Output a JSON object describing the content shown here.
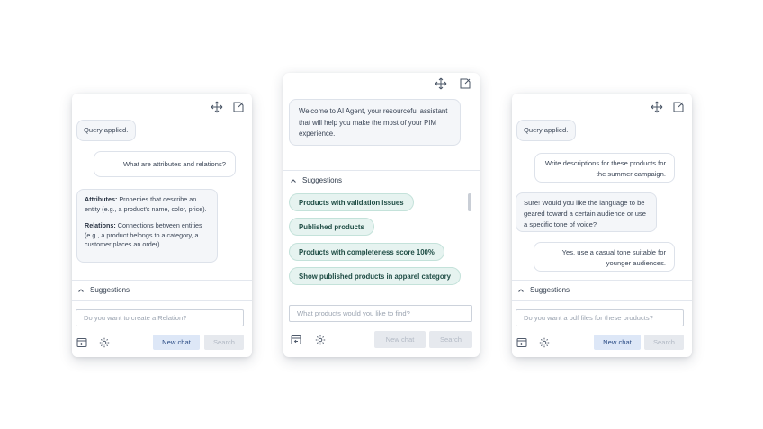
{
  "panels": {
    "left": {
      "msg_query": "Query applied.",
      "msg_user": "What are attributes and relations?",
      "msg_bot": {
        "attr_term": "Attributes:",
        "attr_text": " Properties that describe an entity (e.g., a product's name, color, price).",
        "rel_term": "Relations:",
        "rel_text": " Connections between entities (e.g., a product belongs to a category, a customer places an order)"
      },
      "suggestions_label": "Suggestions",
      "input_placeholder": "Do you want to create a Relation?",
      "new_chat": "New chat",
      "search": "Search"
    },
    "center": {
      "welcome": "Welcome to AI Agent, your resourceful assistant that will help you make the most of your PIM experience.",
      "suggestions_label": "Suggestions",
      "chips": [
        "Products with validation issues",
        "Published products",
        "Products with completeness score 100%",
        "Show published products in apparel category"
      ],
      "input_placeholder": "What products would you like to find?",
      "new_chat": "New chat",
      "search": "Search"
    },
    "right": {
      "msg_query": "Query applied.",
      "msg_user1": "Write descriptions for these products for the summer campaign.",
      "msg_bot": "Sure! Would you like the language to be geared toward a certain audience or use a specific tone of voice?",
      "msg_user2": "Yes, use a casual tone suitable for younger audiences.",
      "suggestions_label": "Suggestions",
      "input_placeholder": "Do you want a pdf files for these products?",
      "new_chat": "New chat",
      "search": "Search"
    }
  },
  "icons": {
    "move": "move-arrows-icon",
    "minimize": "minimize-window-icon",
    "history": "chat-history-icon",
    "settings": "gear-icon",
    "chevron": "chevron-up-icon"
  },
  "colors": {
    "chip_bg": "#e6f3f0",
    "chip_border": "#c4e2da",
    "new_chat_bg": "#dde7f7",
    "disabled_bg": "#e6e9ee"
  }
}
